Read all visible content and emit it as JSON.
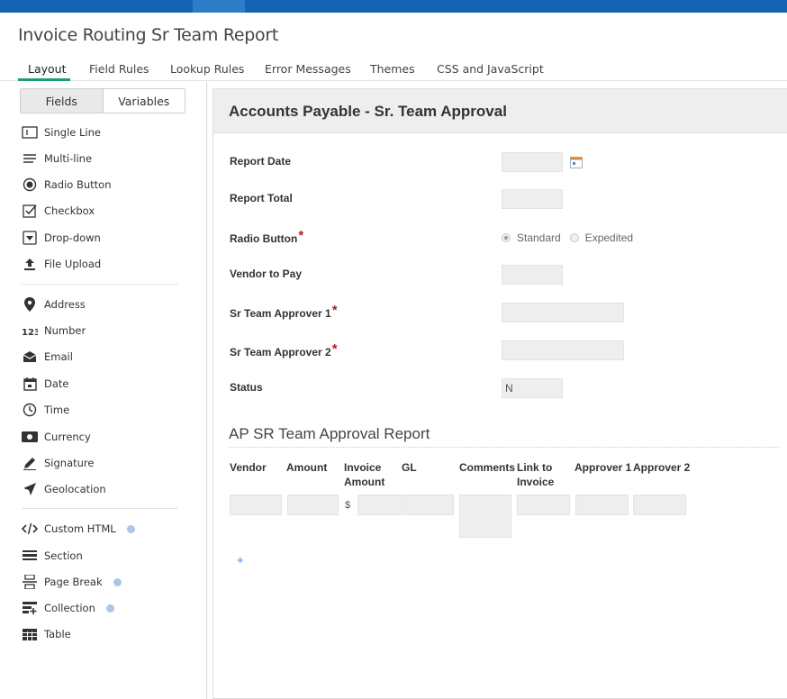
{
  "app": {
    "title": "Invoice Routing Sr Team Report"
  },
  "tabs": [
    {
      "label": "Layout",
      "active": true
    },
    {
      "label": "Field Rules"
    },
    {
      "label": "Lookup Rules"
    },
    {
      "label": "Error Messages"
    },
    {
      "label": "Themes"
    },
    {
      "label": "CSS and JavaScript"
    }
  ],
  "sidebar": {
    "toggle": {
      "fields": "Fields",
      "variables": "Variables",
      "selected": "Fields"
    },
    "items": [
      {
        "label": "Single Line",
        "icon": "single-line-icon"
      },
      {
        "label": "Multi-line",
        "icon": "multi-line-icon"
      },
      {
        "label": "Radio Button",
        "icon": "radio-button-icon"
      },
      {
        "label": "Checkbox",
        "icon": "checkbox-icon"
      },
      {
        "label": "Drop-down",
        "icon": "dropdown-icon"
      },
      {
        "label": "File Upload",
        "icon": "upload-icon"
      },
      {
        "label": "Address",
        "icon": "map-pin-icon"
      },
      {
        "label": "Number",
        "icon": "number-icon"
      },
      {
        "label": "Email",
        "icon": "envelope-icon"
      },
      {
        "label": "Date",
        "icon": "calendar-icon"
      },
      {
        "label": "Time",
        "icon": "clock-icon"
      },
      {
        "label": "Currency",
        "icon": "currency-icon"
      },
      {
        "label": "Signature",
        "icon": "pen-icon"
      },
      {
        "label": "Geolocation",
        "icon": "location-arrow-icon"
      },
      {
        "label": "Custom HTML",
        "icon": "code-icon",
        "help": true
      },
      {
        "label": "Section",
        "icon": "section-icon"
      },
      {
        "label": "Page Break",
        "icon": "page-break-icon",
        "help": true
      },
      {
        "label": "Collection",
        "icon": "collection-icon",
        "help": true
      },
      {
        "label": "Table",
        "icon": "table-icon"
      }
    ]
  },
  "form": {
    "title": "Accounts Payable - Sr. Team Approval",
    "fields": [
      {
        "label": "Report Date",
        "value": ""
      },
      {
        "label": "Report Total",
        "value": ""
      },
      {
        "label": "Radio Button",
        "required": true
      },
      {
        "label": "Vendor to Pay",
        "value": ""
      },
      {
        "label": "Sr Team Approver 1",
        "required": true,
        "value": ""
      },
      {
        "label": "Sr Team Approver 2",
        "required": true,
        "value": ""
      },
      {
        "label": "Status",
        "value": "N"
      }
    ],
    "radio_options": [
      {
        "label": "Standard",
        "selected": true
      },
      {
        "label": "Expedited",
        "selected": false
      }
    ],
    "required_mark": "*",
    "table": {
      "title": "AP SR Team Approval Report",
      "columns": [
        "Vendor",
        "Amount",
        "Invoice Amount",
        "GL",
        "Comments",
        "Link to Invoice",
        "Approver 1",
        "Approver 2"
      ],
      "currency_symbol": "$",
      "add_row": "+"
    }
  },
  "colors": {
    "topbar": "#1464b4",
    "active_tab_underline": "#1a9d6f",
    "required": "#b32020"
  }
}
